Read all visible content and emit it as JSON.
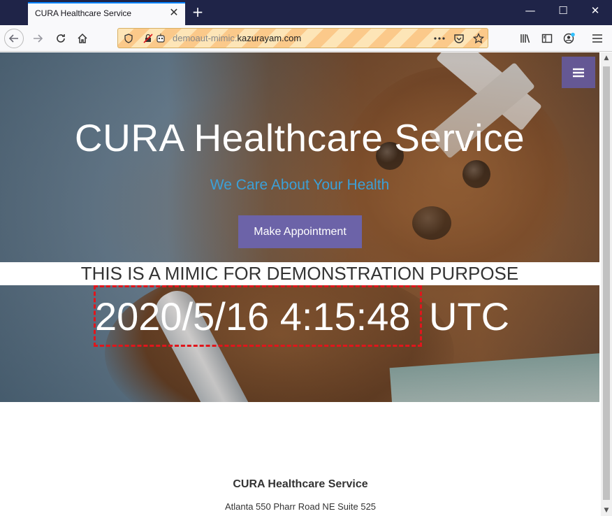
{
  "browser": {
    "tab_title": "CURA Healthcare Service",
    "tab_close": "✕",
    "new_tab": "+",
    "url_prefix": "demoaut-mimic.",
    "url_domain": "kazurayam.com",
    "window_controls": {
      "minimize": "—",
      "maximize": "☐",
      "close": "✕"
    }
  },
  "hero": {
    "title": "CURA Healthcare Service",
    "subtitle": "We Care About Your Health",
    "appointment_button": "Make Appointment",
    "mimic_notice": "THIS IS A MIMIC FOR DEMONSTRATION PURPOSE",
    "clock": "2020/5/16 4:15:48",
    "timezone": "UTC"
  },
  "footer": {
    "title": "CURA Healthcare Service",
    "address": "Atlanta 550 Pharr Road NE Suite 525"
  },
  "colors": {
    "accent": "#6c63a8",
    "subtitle": "#3ba0d8",
    "clock_border": "#e0161c",
    "titlebar": "#1f2448"
  }
}
